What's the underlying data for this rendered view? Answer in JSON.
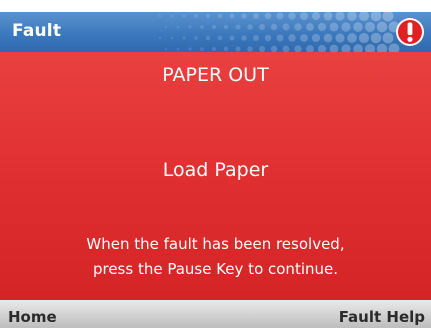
{
  "titlebar": {
    "title": "Fault",
    "icon": "alert-exclamation-icon",
    "color_top": "#5a93cf",
    "color_bottom": "#2f6aae"
  },
  "fault": {
    "headline": "PAPER OUT",
    "message": "Load Paper",
    "instructions_line1": "When the fault has been resolved,",
    "instructions_line2": "press the Pause Key to continue.",
    "panel_color": "#e02f31"
  },
  "softkeys": {
    "left_label": "Home",
    "right_label": "Fault Help"
  }
}
